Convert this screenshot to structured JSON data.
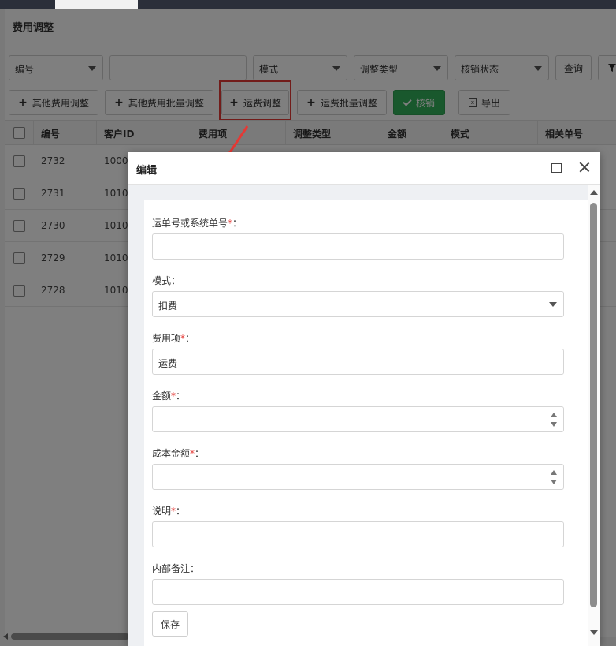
{
  "panel": {
    "title": "费用调整"
  },
  "filters": {
    "number_select": "编号",
    "number_input": "",
    "mode_select": "模式",
    "adjust_type_select": "调整类型",
    "writeoff_status_select": "核销状态",
    "query_label": "查询"
  },
  "toolbar": {
    "other_fee_adjust": "其他费用调整",
    "other_fee_batch_adjust": "其他费用批量调整",
    "freight_adjust": "运费调整",
    "freight_batch_adjust": "运费批量调整",
    "writeoff": "核销",
    "export": "导出"
  },
  "table": {
    "columns": [
      "编号",
      "客户ID",
      "费用项",
      "调整类型",
      "金额",
      "模式",
      "相关单号"
    ],
    "rows": [
      {
        "id": "2732",
        "customer_id": "1000"
      },
      {
        "id": "2731",
        "customer_id": "1010"
      },
      {
        "id": "2730",
        "customer_id": "1010"
      },
      {
        "id": "2729",
        "customer_id": "1010"
      },
      {
        "id": "2728",
        "customer_id": "1010"
      }
    ]
  },
  "dialog": {
    "title": "编辑",
    "fields": {
      "waybill": {
        "label": "运单号或系统单号",
        "required": "*",
        "value": ""
      },
      "mode": {
        "label": "模式",
        "value": "扣费"
      },
      "fee_item": {
        "label": "费用项",
        "required": "*",
        "value": "运费"
      },
      "amount": {
        "label": "金额",
        "required": "*",
        "value": ""
      },
      "cost_amount": {
        "label": "成本金额",
        "required": "*",
        "value": ""
      },
      "description": {
        "label": "说明",
        "required": "*",
        "value": ""
      },
      "internal_note": {
        "label": "内部备注",
        "value": ""
      }
    },
    "colon": "：",
    "save_label": "保存"
  },
  "colors": {
    "accent_green": "#33b05a",
    "highlight_red": "#e53935",
    "required_red": "#e53935"
  }
}
